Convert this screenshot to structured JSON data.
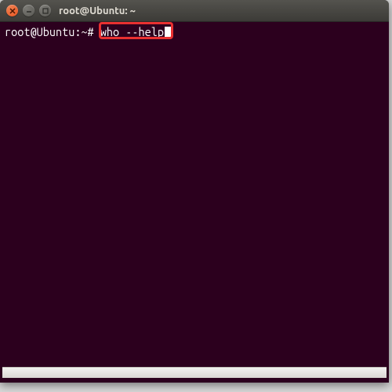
{
  "window": {
    "title": "root@Ubuntu: ~"
  },
  "terminal": {
    "prompt": "root@Ubuntu:~#",
    "command": "who --help"
  },
  "colors": {
    "terminal_bg": "#2c001e",
    "text": "#ffffff",
    "highlight_border": "#e83030",
    "close_btn": "#e95420"
  }
}
